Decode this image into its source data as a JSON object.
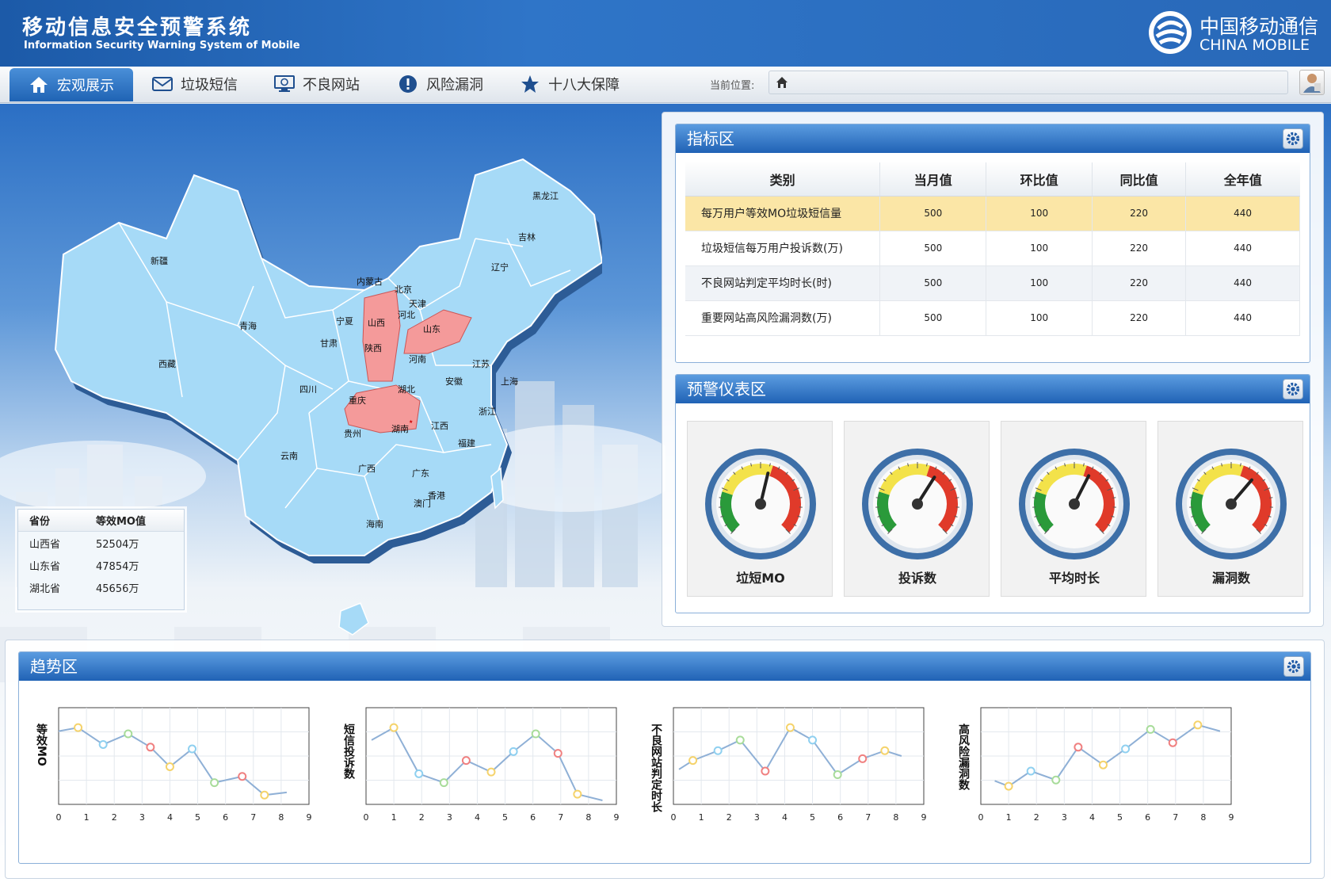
{
  "header": {
    "title_cn": "移动信息安全预警系统",
    "title_en": "Information Security Warning System of Mobile",
    "brand_cn": "中国移动通信",
    "brand_en": "CHINA MOBILE"
  },
  "nav": {
    "items": [
      {
        "label": "宏观展示",
        "icon": "home-icon",
        "active": true
      },
      {
        "label": "垃圾短信",
        "icon": "mail-icon"
      },
      {
        "label": "不良网站",
        "icon": "monitor-icon"
      },
      {
        "label": "风险漏洞",
        "icon": "alert-icon"
      },
      {
        "label": "十八大保障",
        "icon": "star-icon"
      }
    ],
    "location_label": "当前位置:"
  },
  "map": {
    "highlight_color": "#f49a9a",
    "base_color": "#a6daf7",
    "provinces": [
      "黑龙江",
      "吉林",
      "辽宁",
      "内蒙古",
      "新疆",
      "北京",
      "天津",
      "河北",
      "山西",
      "山东",
      "宁夏",
      "青海",
      "甘肃",
      "陕西",
      "河南",
      "江苏",
      "上海",
      "西藏",
      "四川",
      "重庆",
      "湖北",
      "安徽",
      "浙江",
      "贵州",
      "湖南",
      "江西",
      "福建",
      "云南",
      "广西",
      "广东",
      "香港",
      "澳门",
      "海南"
    ],
    "highlighted": [
      "山西",
      "山东",
      "湖北"
    ],
    "legend": {
      "headers": [
        "省份",
        "等效MO值"
      ],
      "rows": [
        [
          "山西省",
          "52504万"
        ],
        [
          "山东省",
          "47854万"
        ],
        [
          "湖北省",
          "45656万"
        ]
      ]
    }
  },
  "indicator": {
    "title": "指标区",
    "headers": [
      "类别",
      "当月值",
      "环比值",
      "同比值",
      "全年值"
    ],
    "rows": [
      [
        "每万用户等效MO垃圾短信量",
        "500",
        "100",
        "220",
        "440"
      ],
      [
        "垃圾短信每万用户投诉数(万)",
        "500",
        "100",
        "220",
        "440"
      ],
      [
        "不良网站判定平均时长(时)",
        "500",
        "100",
        "220",
        "440"
      ],
      [
        "重要网站高风险漏洞数(万)",
        "500",
        "100",
        "220",
        "440"
      ]
    ]
  },
  "gauges": {
    "title": "预警仪表区",
    "items": [
      {
        "label": "垃短MO",
        "needle": 0.55
      },
      {
        "label": "投诉数",
        "needle": 0.62
      },
      {
        "label": "平均时长",
        "needle": 0.6
      },
      {
        "label": "漏洞数",
        "needle": 0.65
      }
    ]
  },
  "trend": {
    "title": "趋势区",
    "chart_data": [
      {
        "type": "line",
        "ylabel": "等效MO",
        "x": [
          0,
          0.7,
          1.6,
          2.5,
          3.3,
          4.0,
          4.8,
          5.6,
          6.6,
          7.4,
          8.2
        ],
        "y": [
          0.78,
          0.82,
          0.63,
          0.75,
          0.6,
          0.38,
          0.58,
          0.2,
          0.27,
          0.06,
          0.09
        ],
        "xticks": [
          0,
          1,
          2,
          3,
          4,
          5,
          6,
          7,
          8,
          9
        ],
        "ylim": [
          0,
          1
        ],
        "xlim": [
          0,
          9
        ]
      },
      {
        "type": "line",
        "ylabel": "短信投诉数",
        "x": [
          0.2,
          1.0,
          1.9,
          2.8,
          3.6,
          4.5,
          5.3,
          6.1,
          6.9,
          7.6,
          8.5
        ],
        "y": [
          0.68,
          0.82,
          0.3,
          0.2,
          0.45,
          0.32,
          0.55,
          0.75,
          0.53,
          0.07,
          0.0
        ],
        "xticks": [
          0,
          1,
          2,
          3,
          4,
          5,
          6,
          7,
          8,
          9
        ],
        "ylim": [
          0,
          1
        ],
        "xlim": [
          0,
          9
        ]
      },
      {
        "type": "line",
        "ylabel": "不良网站判定时长",
        "x": [
          0.2,
          0.7,
          1.6,
          2.4,
          3.3,
          4.2,
          5.0,
          5.9,
          6.8,
          7.6,
          8.2
        ],
        "y": [
          0.35,
          0.45,
          0.56,
          0.68,
          0.33,
          0.82,
          0.68,
          0.29,
          0.47,
          0.56,
          0.5
        ],
        "xticks": [
          0,
          1,
          2,
          3,
          4,
          5,
          6,
          7,
          8,
          9
        ],
        "ylim": [
          0,
          1
        ],
        "xlim": [
          0,
          9
        ]
      },
      {
        "type": "line",
        "ylabel": "高风险漏洞数",
        "x": [
          0.5,
          1.0,
          1.8,
          2.7,
          3.5,
          4.4,
          5.2,
          6.1,
          6.9,
          7.8,
          8.6
        ],
        "y": [
          0.22,
          0.16,
          0.33,
          0.23,
          0.6,
          0.4,
          0.58,
          0.8,
          0.65,
          0.85,
          0.78
        ],
        "xticks": [
          0,
          1,
          2,
          3,
          4,
          5,
          6,
          7,
          8,
          9
        ],
        "ylim": [
          0,
          1
        ],
        "xlim": [
          0,
          9
        ]
      }
    ]
  }
}
